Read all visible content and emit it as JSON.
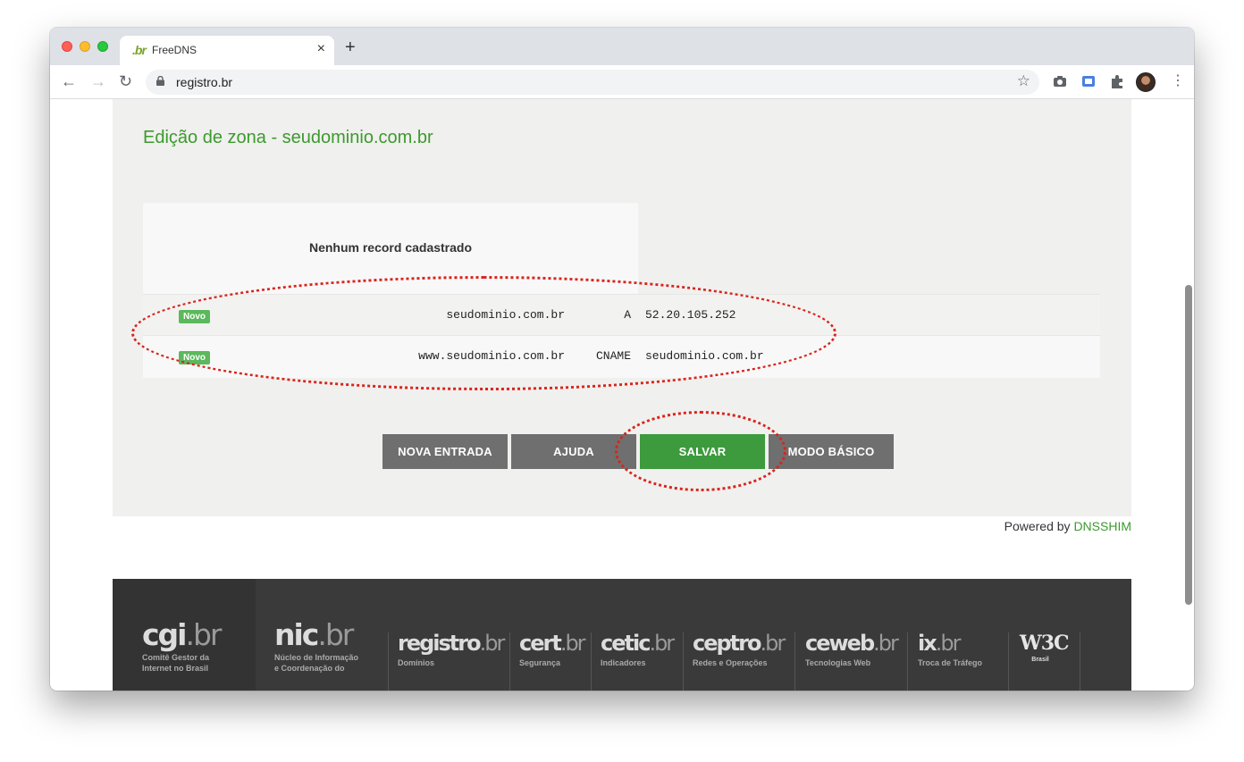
{
  "browser": {
    "tab_title": "FreeDNS",
    "tab_favicon": ".br",
    "new_tab_label": "+",
    "url": "registro.br"
  },
  "page": {
    "title": "Edição de zona - seudominio.com.br",
    "empty_message": "Nenhum record cadastrado",
    "records": [
      {
        "badge": "Novo",
        "name": "seudominio.com.br",
        "type": "A",
        "value": "52.20.105.252"
      },
      {
        "badge": "Novo",
        "name": "www.seudominio.com.br",
        "type": "CNAME",
        "value": "seudominio.com.br"
      }
    ],
    "buttons": {
      "nova_entrada": "NOVA ENTRADA",
      "ajuda": "AJUDA",
      "salvar": "SALVAR",
      "modo_basico": "MODO BÁSICO"
    },
    "powered_by": "Powered by",
    "powered_link": "DNSSHIM",
    "accent_color": "#3c9a2e",
    "annotation_color": "#d9241c"
  },
  "footer": {
    "logos": [
      {
        "name": "cgi",
        "suffix": ".br",
        "sub1": "Comitê Gestor da",
        "sub2": "Internet no Brasil"
      },
      {
        "name": "nic",
        "suffix": ".br",
        "sub1": "Núcleo de Informação",
        "sub2": "e Coordenação do"
      },
      {
        "name": "registro",
        "suffix": ".br",
        "sub1": "Domínios"
      },
      {
        "name": "cert",
        "suffix": ".br",
        "sub1": "Segurança"
      },
      {
        "name": "cetic",
        "suffix": ".br",
        "sub1": "Indicadores"
      },
      {
        "name": "ceptro",
        "suffix": ".br",
        "sub1": "Redes e Operações"
      },
      {
        "name": "ceweb",
        "suffix": ".br",
        "sub1": "Tecnologias Web"
      },
      {
        "name": "ix",
        "suffix": ".br",
        "sub1": "Troca de Tráfego"
      },
      {
        "name": "W3C",
        "sub1": "Brasil"
      }
    ]
  }
}
